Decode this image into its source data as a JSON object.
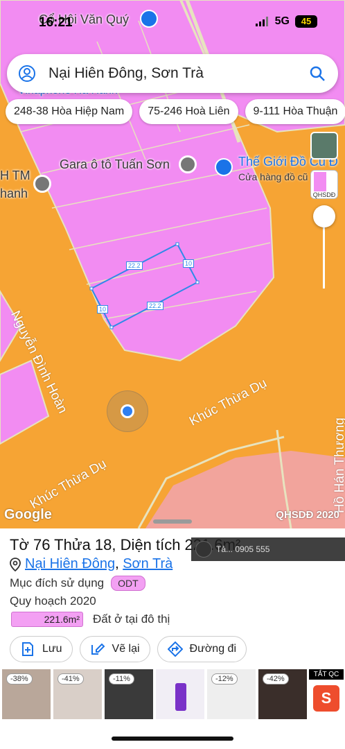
{
  "status_bar": {
    "time": "16:21",
    "network": "5G",
    "battery": "45"
  },
  "search": {
    "text": "Nại Hiên Đông, Sơn Trà"
  },
  "chips": [
    "248-38 Hòa Hiệp Nam",
    "75-246 Hoà Liên",
    "9-111 Hòa Thuận"
  ],
  "map": {
    "streets": {
      "nguyen_dinh_hoan": "Nguyễn Đình Hoàn",
      "khuc_thua_du_1": "Khúc Thừa Dụ",
      "khuc_thua_du_2": "Khúc Thừa Dụ",
      "ho_hien_thuong": "Hồ Hán Thương"
    },
    "pois": {
      "top": "Cổ Hội Văn Quý",
      "vinaphone": "Vinaphone Hà Hành",
      "gara": "Gara ô tô Tuấn Sơn",
      "the_gioi": "Thế Giới Đồ Cũ Đ",
      "the_gioi_sub": "Cửa hàng đồ cũ",
      "left_tm": "H TM",
      "left_thanh": "hanh"
    },
    "parcel_dims": {
      "top": "22.2",
      "bottom": "22.2",
      "left": "10",
      "right": "10"
    },
    "qhsdd_label": "QHSDĐ",
    "google": "Google",
    "watermark": "QHSDĐ 2020"
  },
  "sheet": {
    "title": "Tờ 76 Thửa 18, Diện tích 221.6m²",
    "ad_strip": "Tả... 0905 555",
    "addr_ward": "Nại Hiên Đông",
    "addr_sep": ", ",
    "addr_district": "Sơn Trà",
    "purpose_label": "Mục đích sử dụng",
    "purpose_badge": "ODT",
    "planning_label": "Quy hoạch 2020",
    "area_value": "221.6m²",
    "area_desc": "Đất ở tại đô thị",
    "buttons": {
      "save": "Lưu",
      "redraw": "Vẽ lại",
      "directions": "Đường đi"
    },
    "ads": [
      "-38%",
      "-41%",
      "-11%",
      "",
      "-12%",
      "-42%"
    ],
    "ad_tag": "TẮT QC",
    "ad_shop": "S"
  }
}
